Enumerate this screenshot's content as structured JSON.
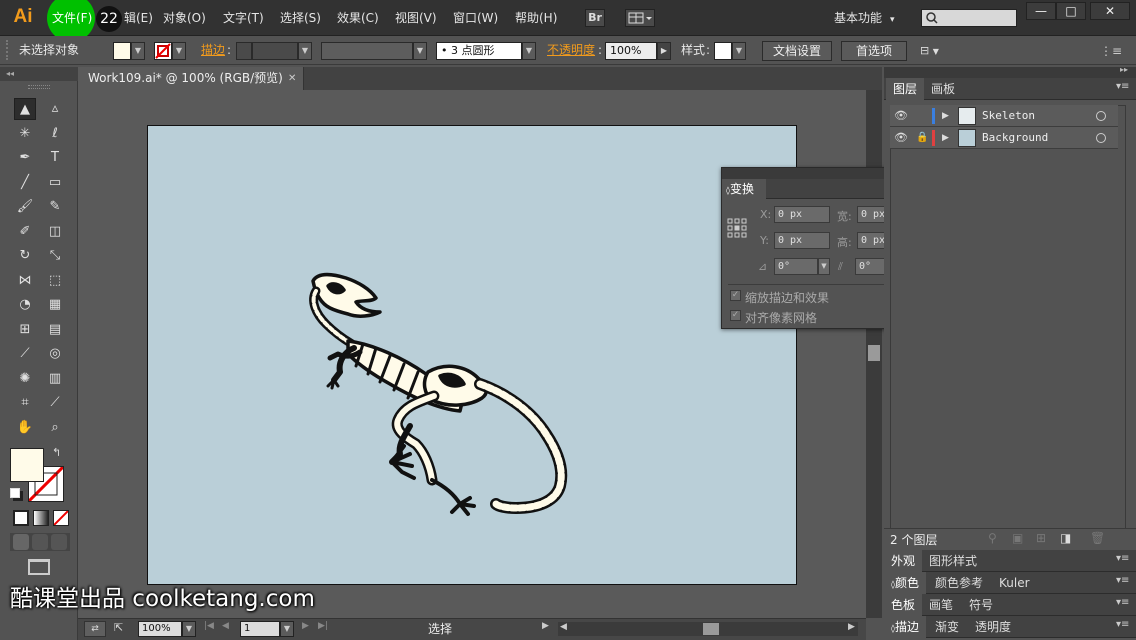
{
  "app": {
    "logo": "Ai",
    "step_badge": "22"
  },
  "menu": {
    "file": "文件(F)",
    "edit_partial": "辑(E)",
    "object": "对象(O)",
    "type": "文字(T)",
    "select": "选择(S)",
    "effect": "效果(C)",
    "view": "视图(V)",
    "window": "窗口(W)",
    "help": "帮助(H)",
    "bridge": "Br",
    "workspace": "基本功能",
    "search_placeholder": "",
    "min": "—",
    "max": "□",
    "close": "✕"
  },
  "control": {
    "no_selection": "未选择对象",
    "stroke": "描边",
    "brush": "3 点圆形",
    "opacity": "不透明度",
    "opacity_value": "100%",
    "style": "样式",
    "doc_settings": "文档设置",
    "preferences": "首选项"
  },
  "document": {
    "tab_title": "Work109.ai* @ 100% (RGB/预览)",
    "tab_close": "✕"
  },
  "status": {
    "zoom": "100%",
    "page": "1",
    "mode": "选择"
  },
  "layers_panel": {
    "tab_layers": "图层",
    "tab_artboards": "画板",
    "layers": [
      {
        "name": "Skeleton",
        "color": "#3a7fe0",
        "locked": false
      },
      {
        "name": "Background",
        "color": "#e04040",
        "locked": true
      }
    ],
    "count_label": "2 个图层"
  },
  "panels": {
    "appearance": "外观",
    "graphic_styles": "图形样式",
    "color": "颜色",
    "color_guide": "颜色参考",
    "kuler": "Kuler",
    "swatches": "色板",
    "brushes": "画笔",
    "symbols": "符号",
    "stroke": "描边",
    "gradient": "渐变",
    "transparency": "透明度"
  },
  "transform_panel": {
    "title": "变换",
    "x_label": "X:",
    "y_label": "Y:",
    "w_label": "宽:",
    "h_label": "高:",
    "x": "0 px",
    "y": "0 px",
    "w": "0 px",
    "h": "0 px",
    "rotate": "0°",
    "shear": "0°",
    "scale_strokes": "缩放描边和效果",
    "align_pixel": "对齐像素网格"
  },
  "watermark": "酷课堂出品 coolketang.com",
  "colors": {
    "accent": "#f29b1c",
    "artboard": "#bacfd8",
    "click": "#00c000"
  }
}
